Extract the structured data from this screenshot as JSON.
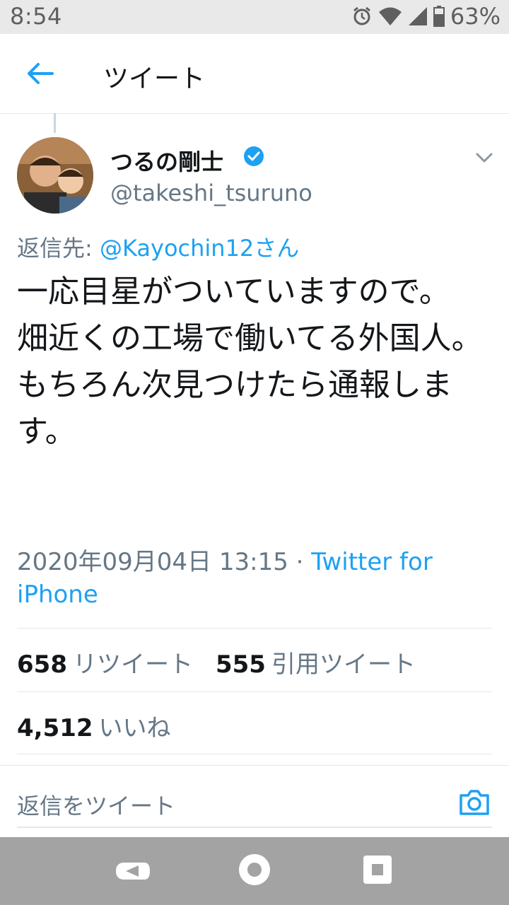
{
  "status_bar": {
    "time": "8:54",
    "battery_percent": "63%",
    "icons": [
      "alarm-icon",
      "wifi-icon",
      "signal-icon",
      "battery-icon"
    ]
  },
  "header": {
    "title": "ツイート",
    "back_icon": "arrow-left-icon"
  },
  "tweet": {
    "author_name": "つるの剛士",
    "author_handle": "@takeshi_tsuruno",
    "verified": true,
    "reply_prefix": "返信先:",
    "reply_mention": "@Kayochin12さん",
    "text": "一応目星がついていますので。\n畑近くの工場で働いてる外国人。\nもちろん次見つけたら通報します。",
    "timestamp": "2020年09月04日 13:15",
    "separator": "·",
    "source": "Twitter for iPhone"
  },
  "stats": {
    "retweets_count": "658",
    "retweets_label": "リツイート",
    "quotes_count": "555",
    "quotes_label": "引用ツイート",
    "likes_count": "4,512",
    "likes_label": "いいね"
  },
  "reply": {
    "placeholder": "返信をツイート",
    "camera_icon": "camera-icon"
  },
  "colors": {
    "accent": "#1da1f2",
    "secondary_text": "#657786",
    "divider": "#e1e8ed",
    "status_bar": "#e9e9e9",
    "nav_bar": "#a3a3a3"
  }
}
